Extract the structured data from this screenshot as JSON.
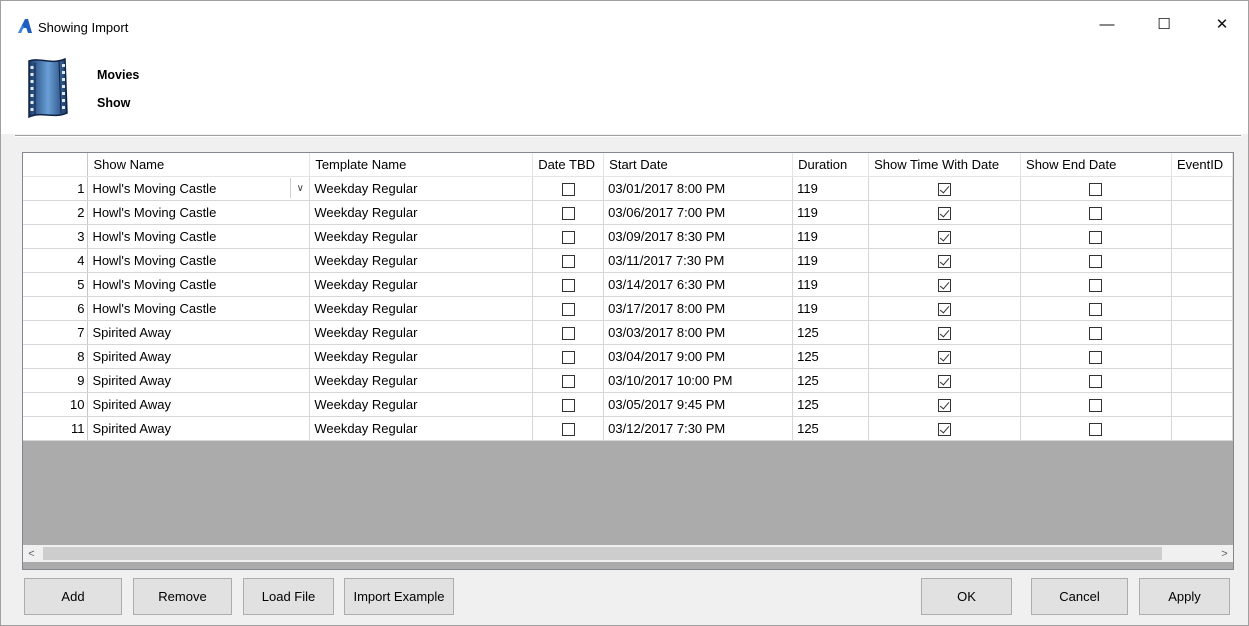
{
  "window": {
    "title": "Showing Import",
    "minimize_glyph": "—",
    "maximize_glyph": "☐",
    "close_glyph": "✕"
  },
  "header": {
    "label_1": "Movies",
    "label_2": "Show",
    "icon": "film-strip-icon"
  },
  "grid": {
    "columns": [
      "",
      "Show Name",
      "Template Name",
      "Date TBD",
      "Start Date",
      "Duration",
      "Show Time With Date",
      "Show End Date",
      "EventID"
    ],
    "rows": [
      {
        "num": "1",
        "show": "Howl's Moving Castle",
        "template": "Weekday Regular",
        "date_tbd": false,
        "start": "03/01/2017 8:00 PM",
        "duration": "119",
        "time_with_date": true,
        "end_date": false,
        "event_id": ""
      },
      {
        "num": "2",
        "show": "Howl's Moving Castle",
        "template": "Weekday Regular",
        "date_tbd": false,
        "start": "03/06/2017 7:00 PM",
        "duration": "119",
        "time_with_date": true,
        "end_date": false,
        "event_id": ""
      },
      {
        "num": "3",
        "show": "Howl's Moving Castle",
        "template": "Weekday Regular",
        "date_tbd": false,
        "start": "03/09/2017 8:30 PM",
        "duration": "119",
        "time_with_date": true,
        "end_date": false,
        "event_id": ""
      },
      {
        "num": "4",
        "show": "Howl's Moving Castle",
        "template": "Weekday Regular",
        "date_tbd": false,
        "start": "03/11/2017 7:30 PM",
        "duration": "119",
        "time_with_date": true,
        "end_date": false,
        "event_id": ""
      },
      {
        "num": "5",
        "show": "Howl's Moving Castle",
        "template": "Weekday Regular",
        "date_tbd": false,
        "start": "03/14/2017 6:30 PM",
        "duration": "119",
        "time_with_date": true,
        "end_date": false,
        "event_id": ""
      },
      {
        "num": "6",
        "show": "Howl's Moving Castle",
        "template": "Weekday Regular",
        "date_tbd": false,
        "start": "03/17/2017 8:00 PM",
        "duration": "119",
        "time_with_date": true,
        "end_date": false,
        "event_id": ""
      },
      {
        "num": "7",
        "show": "Spirited Away",
        "template": "Weekday Regular",
        "date_tbd": false,
        "start": "03/03/2017 8:00 PM",
        "duration": "125",
        "time_with_date": true,
        "end_date": false,
        "event_id": ""
      },
      {
        "num": "8",
        "show": "Spirited Away",
        "template": "Weekday Regular",
        "date_tbd": false,
        "start": "03/04/2017 9:00 PM",
        "duration": "125",
        "time_with_date": true,
        "end_date": false,
        "event_id": ""
      },
      {
        "num": "9",
        "show": "Spirited Away",
        "template": "Weekday Regular",
        "date_tbd": false,
        "start": "03/10/2017 10:00 PM",
        "duration": "125",
        "time_with_date": true,
        "end_date": false,
        "event_id": ""
      },
      {
        "num": "10",
        "show": "Spirited Away",
        "template": "Weekday Regular",
        "date_tbd": false,
        "start": "03/05/2017 9:45 PM",
        "duration": "125",
        "time_with_date": true,
        "end_date": false,
        "event_id": ""
      },
      {
        "num": "11",
        "show": "Spirited Away",
        "template": "Weekday Regular",
        "date_tbd": false,
        "start": "03/12/2017 7:30 PM",
        "duration": "125",
        "time_with_date": true,
        "end_date": false,
        "event_id": ""
      }
    ],
    "combo_arrow_glyph": "∨",
    "scroll_left_glyph": "<",
    "scroll_right_glyph": ">"
  },
  "buttons": {
    "add": "Add",
    "remove": "Remove",
    "load_file": "Load File",
    "import_example": "Import Example",
    "ok": "OK",
    "cancel": "Cancel",
    "apply": "Apply"
  },
  "colors": {
    "accent": "#1f5fbf",
    "grid_empty": "#ababab",
    "button_face": "#e1e1e1"
  }
}
